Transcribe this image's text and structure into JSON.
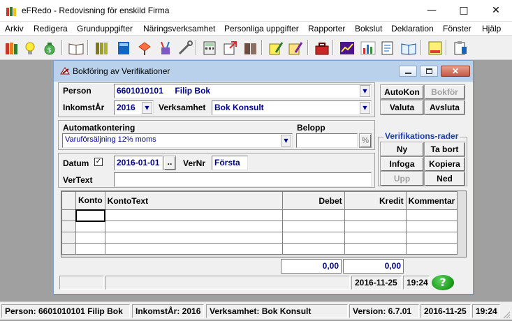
{
  "app": {
    "title": "eFRedo - Redovisning för enskild Firma"
  },
  "menu": [
    "Arkiv",
    "Redigera",
    "Grunduppgifter",
    "Näringsverksamhet",
    "Personliga uppgifter",
    "Rapporter",
    "Bokslut",
    "Deklaration",
    "Fönster",
    "Hjälp"
  ],
  "toolbar": {
    "icons": [
      "books-icon",
      "lightbulb-icon",
      "money-bag-icon",
      "open-book-icon",
      "ledgers-icon",
      "blue-book-icon",
      "signpost-icon",
      "pen-cup-icon",
      "tools-icon",
      "calculator-icon",
      "export-icon",
      "book-stack-icon",
      "highlighter-book-icon",
      "pencil-book-icon",
      "toolbox-icon",
      "line-chart-icon",
      "bar-chart-icon",
      "notepad-icon",
      "reader-icon",
      "tax-form-icon",
      "clipboard-icon"
    ]
  },
  "window": {
    "title": "Bokföring av Verifikationer",
    "person_label": "Person",
    "person_id": "6601010101",
    "person_name": "Filip Bok",
    "year_label": "InkomstÅr",
    "year": "2016",
    "business_label": "Verksamhet",
    "business": "Bok Konsult",
    "buttons": {
      "autokon": "AutoKon",
      "bokfor": "Bokför",
      "valuta": "Valuta",
      "avsluta": "Avsluta"
    },
    "auto_label": "Automatkontering",
    "auto_value": "Varuförsäljning 12% moms",
    "belopp_label": "Belopp",
    "belopp_value": "",
    "percent_label": "%",
    "verrows_label": "Verifikations-rader",
    "row_buttons": {
      "ny": "Ny",
      "tabort": "Ta bort",
      "infoga": "Infoga",
      "kopiera": "Kopiera",
      "upp": "Upp",
      "ned": "Ned"
    },
    "datum_label": "Datum",
    "datum_checked": true,
    "datum_value": "2016-01-01",
    "datum_btn": "..",
    "vernr_label": "VerNr",
    "vernr_value": "Första",
    "vertext_label": "VerText",
    "vertext_value": "",
    "grid": {
      "headers": [
        "Konto",
        "KontoText",
        "Debet",
        "Kredit",
        "Kommentar"
      ],
      "rows": 4
    },
    "total_debet": "0,00",
    "total_kredit": "0,00",
    "status_date": "2016-11-25",
    "status_time": "19:24",
    "help_symbol": "?"
  },
  "statusbar": {
    "person": "Person: 6601010101  Filip Bok",
    "year": "InkomstÅr: 2016",
    "business": "Verksamhet: Bok Konsult",
    "version": "Version: 6.7.01",
    "date": "2016-11-25",
    "time": "19:24"
  },
  "colors": {
    "value_blue": "#00008b",
    "title_active": "#b9d1ea",
    "help_green": "#1a9b1a"
  }
}
